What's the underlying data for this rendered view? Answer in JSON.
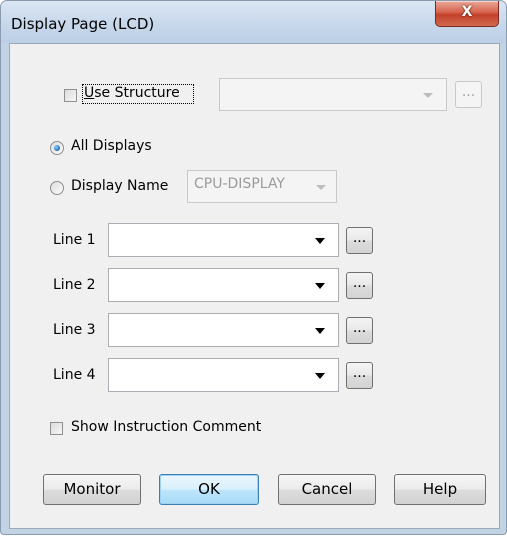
{
  "window": {
    "title": "Display Page (LCD)",
    "close_glyph": "X",
    "close_icon": "close-icon"
  },
  "use_structure": {
    "label_accel": "U",
    "label_rest": "se Structure",
    "checked": false,
    "combo_value": "",
    "browse_label": "..."
  },
  "display_mode": {
    "all_displays_label": "All Displays",
    "all_displays_selected": true,
    "display_name_label": "Display Name",
    "display_name_selected": false,
    "display_name_value": "CPU-DISPLAY"
  },
  "lines": [
    {
      "label": "Line 1",
      "value": "",
      "browse_label": "..."
    },
    {
      "label": "Line 2",
      "value": "",
      "browse_label": "..."
    },
    {
      "label": "Line 3",
      "value": "",
      "browse_label": "..."
    },
    {
      "label": "Line 4",
      "value": "",
      "browse_label": "..."
    }
  ],
  "show_comment": {
    "label": "Show Instruction Comment",
    "checked": false
  },
  "buttons": {
    "monitor": "Monitor",
    "ok": "OK",
    "cancel": "Cancel",
    "help": "Help"
  }
}
